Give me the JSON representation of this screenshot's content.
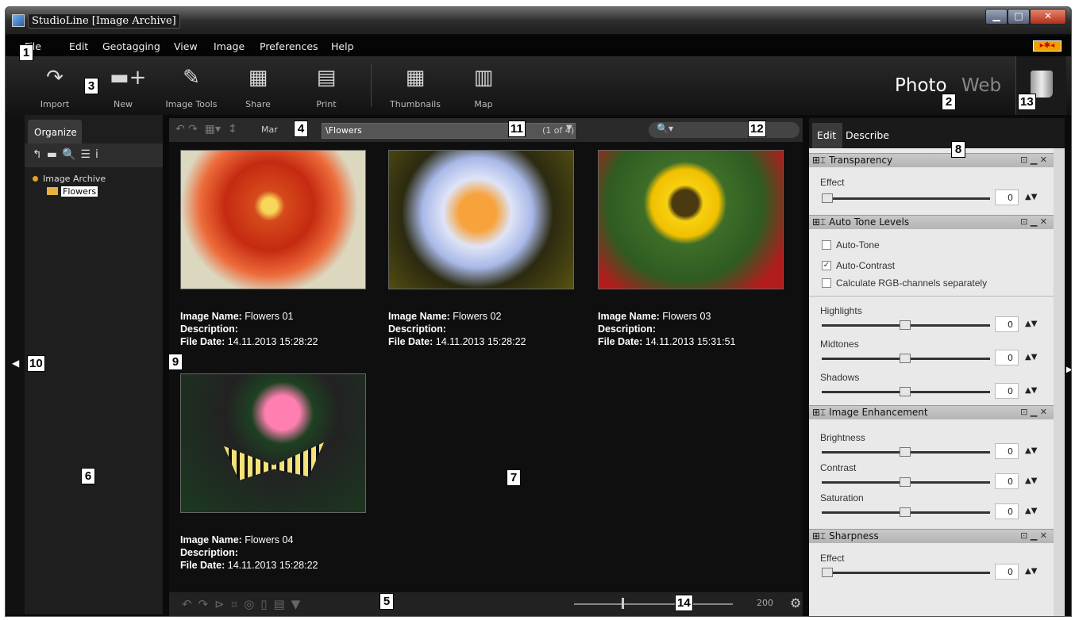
{
  "window": {
    "title": "StudioLine [Image Archive]",
    "min": "▁",
    "max": "□",
    "close": "✕"
  },
  "menu": [
    "File",
    "Edit",
    "Geotagging",
    "View",
    "Image",
    "Preferences",
    "Help"
  ],
  "toolbar": [
    {
      "label": "Import",
      "icon": "import-arrow-icon",
      "glyph": "↷"
    },
    {
      "label": "New",
      "icon": "new-folder-icon",
      "glyph": "▬+"
    },
    {
      "label": "Image Tools",
      "icon": "pipette-icon",
      "glyph": "✎"
    },
    {
      "label": "Share",
      "icon": "share-icon",
      "glyph": "▦"
    },
    {
      "label": "Print",
      "icon": "printer-icon",
      "glyph": "▤"
    },
    {
      "label": "Thumbnails",
      "icon": "thumbnails-icon",
      "glyph": "▦"
    },
    {
      "label": "Map",
      "icon": "map-icon",
      "glyph": "▥"
    }
  ],
  "modes": {
    "photo": "Photo",
    "web": "Web"
  },
  "left": {
    "tab": "Organize",
    "tools": "↰▬🔍☰i",
    "tree_root": "Image Archive",
    "tree_child": "Flowers"
  },
  "center": {
    "sort_label": "Mar",
    "path": "\\Flowers",
    "count": "(1 of 4)",
    "images": [
      {
        "name": "Flowers 01",
        "description": "",
        "date": "14.11.2013 15:28:22"
      },
      {
        "name": "Flowers 02",
        "description": "",
        "date": "14.11.2013 15:28:22"
      },
      {
        "name": "Flowers 03",
        "description": "",
        "date": "14.11.2013 15:31:51"
      },
      {
        "name": "Flowers 04",
        "description": "",
        "date": "14.11.2013 15:28:22"
      }
    ],
    "meta_labels": {
      "name": "Image Name:",
      "description": "Description:",
      "date": "File Date:"
    },
    "zoom": "200"
  },
  "right": {
    "tab_edit": "Edit",
    "tab_describe": "Describe",
    "transparency": {
      "title": "Transparency",
      "effect_label": "Effect",
      "effect_value": "0"
    },
    "autotone": {
      "title": "Auto Tone Levels",
      "auto_tone": "Auto-Tone",
      "auto_contrast": "Auto-Contrast",
      "rgb": "Calculate RGB-channels separately",
      "highlights": "Highlights",
      "highlights_value": "0",
      "midtones": "Midtones",
      "midtones_value": "0",
      "shadows": "Shadows",
      "shadows_value": "0"
    },
    "enhancement": {
      "title": "Image Enhancement",
      "brightness": "Brightness",
      "brightness_value": "0",
      "contrast": "Contrast",
      "contrast_value": "0",
      "saturation": "Saturation",
      "saturation_value": "0"
    },
    "sharpness": {
      "title": "Sharpness",
      "effect_label": "Effect",
      "effect_value": "0"
    }
  },
  "callouts": [
    "1",
    "2",
    "3",
    "4",
    "5",
    "6",
    "7",
    "8",
    "9",
    "10",
    "11",
    "12",
    "13",
    "14"
  ]
}
